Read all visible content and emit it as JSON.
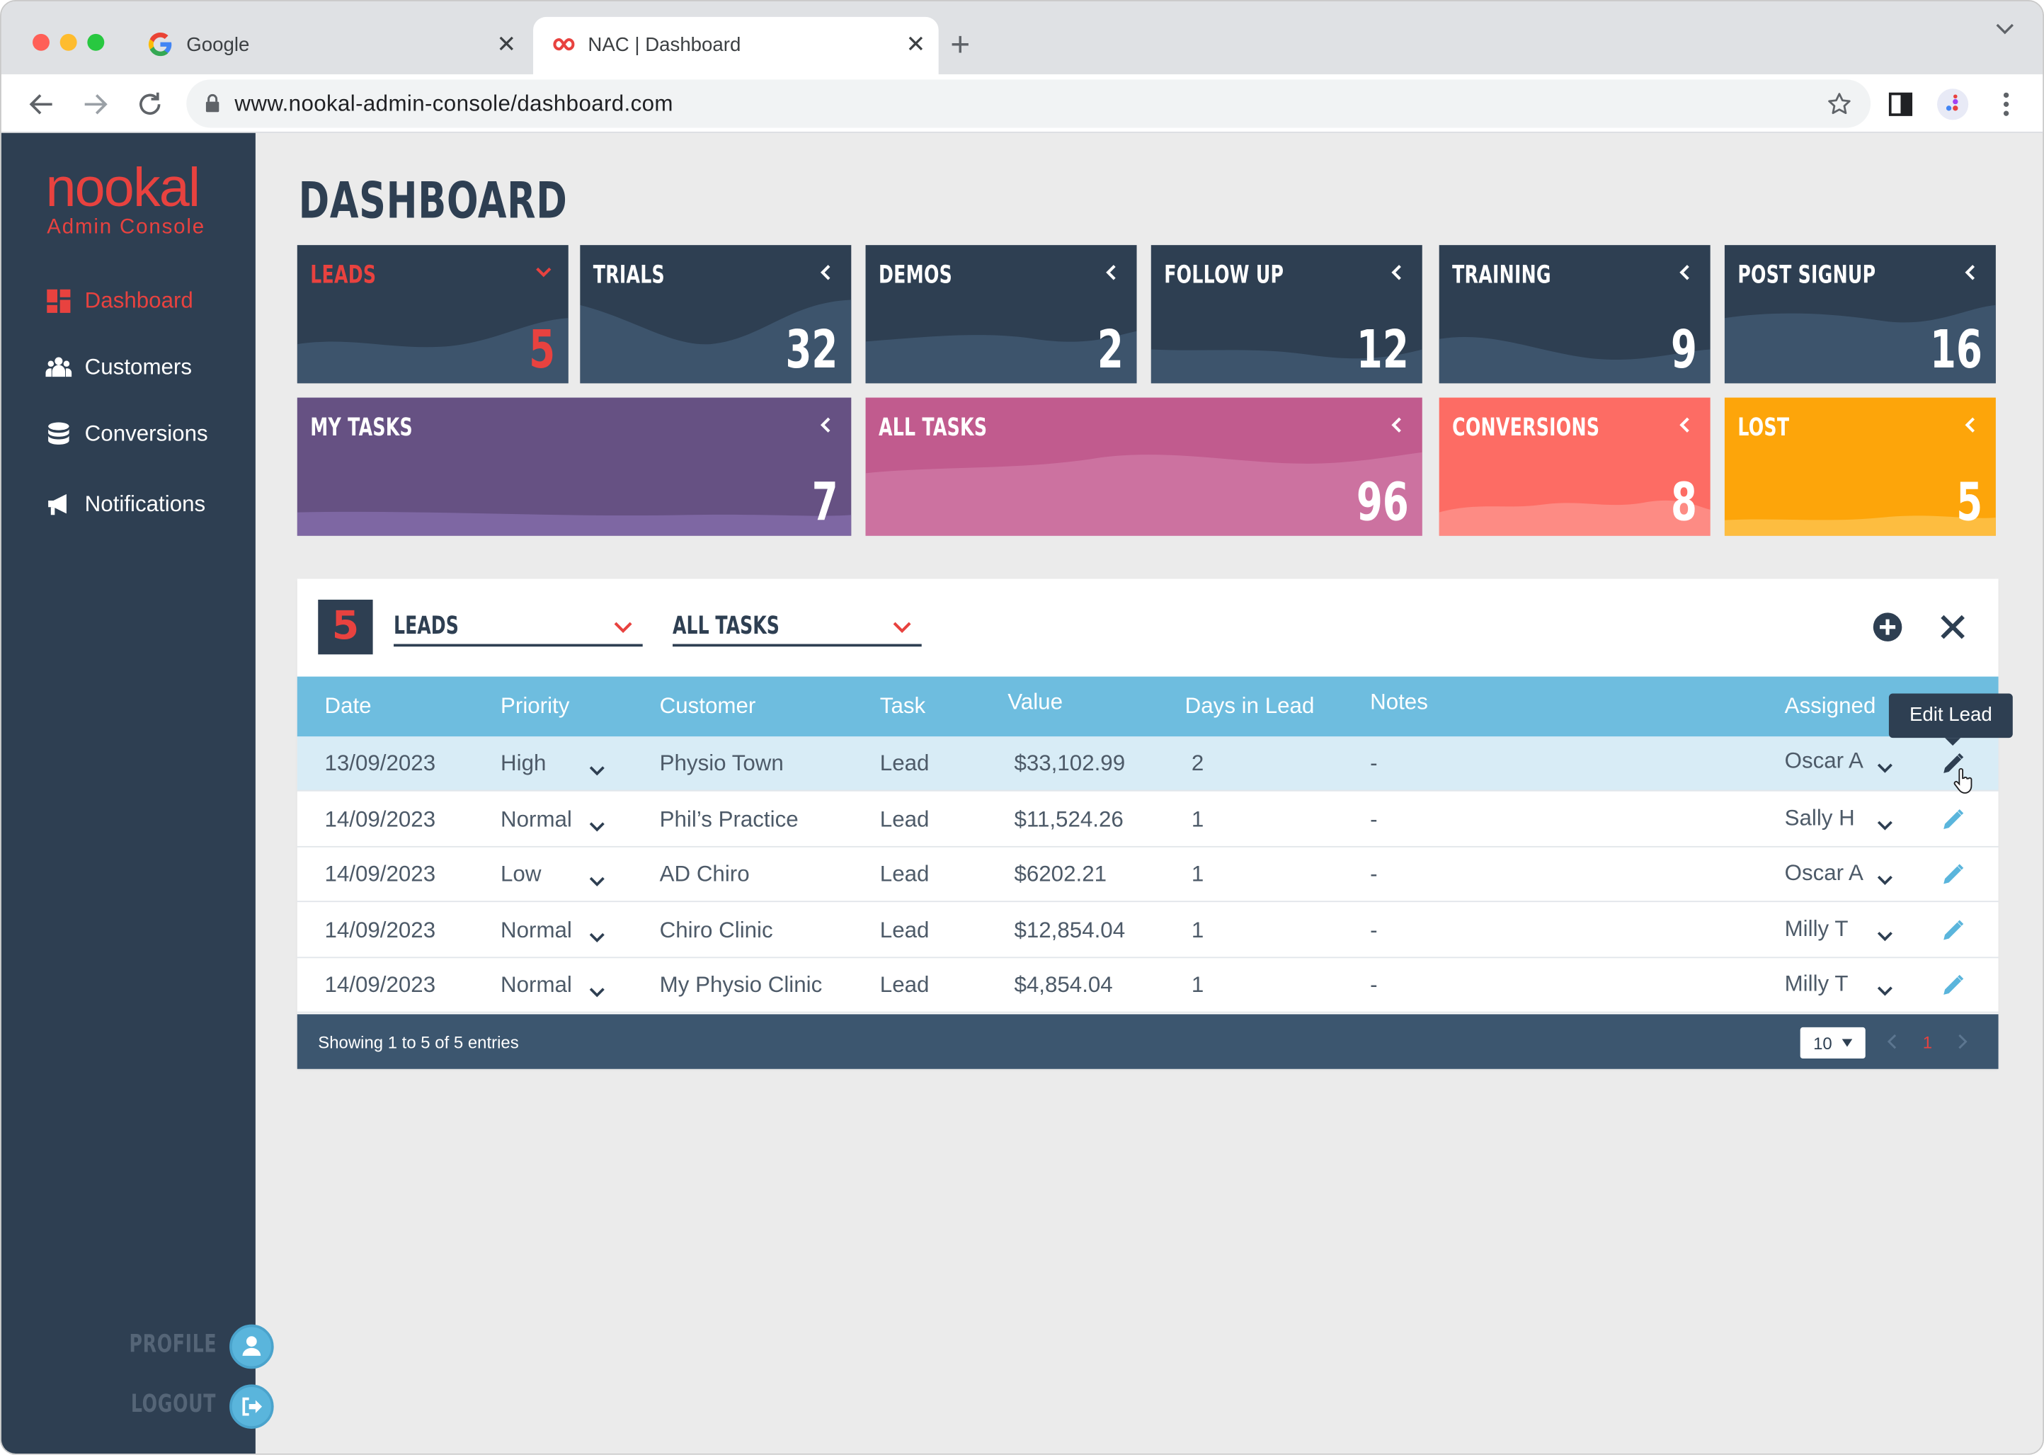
{
  "browser": {
    "tabs": [
      {
        "title": "Google",
        "active": false
      },
      {
        "title": "NAC | Dashboard",
        "active": true
      }
    ],
    "url": "www.nookal-admin-console/dashboard.com"
  },
  "sidebar": {
    "logo": "nookal",
    "logo_sub": "Admin Console",
    "items": [
      {
        "label": "Dashboard",
        "icon": "dashboard-icon",
        "active": true
      },
      {
        "label": "Customers",
        "icon": "customers-icon",
        "active": false
      },
      {
        "label": "Conversions",
        "icon": "database-icon",
        "active": false
      },
      {
        "label": "Notifications",
        "icon": "megaphone-icon",
        "active": false
      }
    ],
    "profile_label": "PROFILE",
    "logout_label": "LOGOUT"
  },
  "page": {
    "title": "DASHBOARD"
  },
  "cards": [
    {
      "title": "LEADS",
      "value": "5",
      "color": "#2e3f52",
      "accent": "#e8423f",
      "expanded": true
    },
    {
      "title": "TRIALS",
      "value": "32",
      "color": "#2e3f52"
    },
    {
      "title": "DEMOS",
      "value": "2",
      "color": "#2e3f52"
    },
    {
      "title": "FOLLOW UP",
      "value": "12",
      "color": "#2e3f52"
    },
    {
      "title": "TRAINING",
      "value": "9",
      "color": "#2e3f52"
    },
    {
      "title": "POST SIGNUP",
      "value": "16",
      "color": "#2e3f52"
    },
    {
      "title": "MY TASKS",
      "value": "7",
      "color": "#665183"
    },
    {
      "title": "ALL TASKS",
      "value": "96",
      "color": "#c15b8e"
    },
    {
      "title": "CONVERSIONS",
      "value": "8",
      "color": "#fd6c64"
    },
    {
      "title": "LOST",
      "value": "5",
      "color": "#fda50a"
    }
  ],
  "panel": {
    "count": "5",
    "filter1": "LEADS",
    "filter2": "ALL TASKS",
    "columns": [
      "Date",
      "Priority",
      "Customer",
      "Task",
      "Value",
      "Days in Lead",
      "Notes",
      "Assigned"
    ],
    "tooltip": "Edit Lead",
    "rows": [
      {
        "date": "13/09/2023",
        "priority": "High",
        "customer": "Physio Town",
        "task": "Lead",
        "value": "$33,102.99",
        "days": "2",
        "notes": "-",
        "assigned": "Oscar A"
      },
      {
        "date": "14/09/2023",
        "priority": "Normal",
        "customer": "Phil’s Practice",
        "task": "Lead",
        "value": "$11,524.26",
        "days": "1",
        "notes": "-",
        "assigned": "Sally H"
      },
      {
        "date": "14/09/2023",
        "priority": "Low",
        "customer": "AD Chiro",
        "task": "Lead",
        "value": "$6202.21",
        "days": "1",
        "notes": "-",
        "assigned": "Oscar A"
      },
      {
        "date": "14/09/2023",
        "priority": "Normal",
        "customer": "Chiro Clinic",
        "task": "Lead",
        "value": "$12,854.04",
        "days": "1",
        "notes": "-",
        "assigned": "Milly T"
      },
      {
        "date": "14/09/2023",
        "priority": "Normal",
        "customer": "My Physio Clinic",
        "task": "Lead",
        "value": "$4,854.04",
        "days": "1",
        "notes": "-",
        "assigned": "Milly T"
      }
    ],
    "footer": "Showing 1 to 5 of 5 entries",
    "page_size": "10",
    "current_page": "1"
  }
}
